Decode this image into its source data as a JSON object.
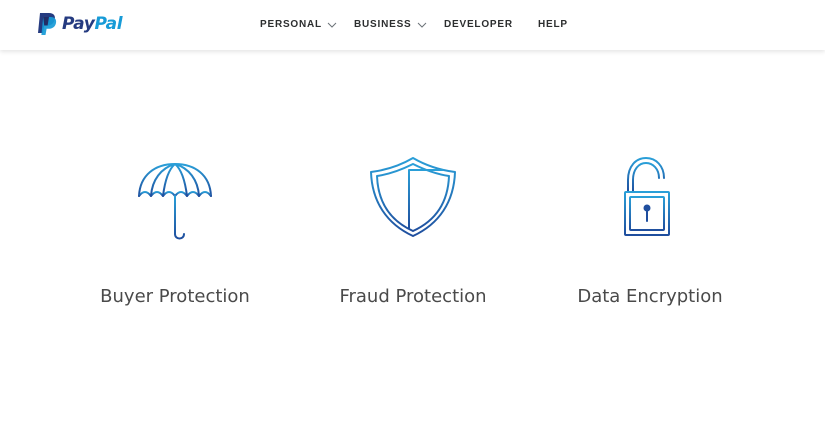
{
  "header": {
    "logo": {
      "text_pay": "Pay",
      "text_pal": "Pal",
      "icon": "paypal-logo-icon"
    },
    "nav": [
      {
        "label": "PERSONAL",
        "has_dropdown": true,
        "icon": "chevron-down-icon"
      },
      {
        "label": "BUSINESS",
        "has_dropdown": true,
        "icon": "chevron-down-icon"
      },
      {
        "label": "DEVELOPER",
        "has_dropdown": false
      },
      {
        "label": "HELP",
        "has_dropdown": false
      }
    ]
  },
  "features": [
    {
      "label": "Buyer Protection",
      "icon": "umbrella-icon"
    },
    {
      "label": "Fraud Protection",
      "icon": "shield-icon"
    },
    {
      "label": "Data Encryption",
      "icon": "unlocked-padlock-icon"
    }
  ],
  "colors": {
    "brand_dark_blue": "#253b80",
    "brand_light_blue": "#179bd7",
    "icon_stroke_light": "#2a9fd8",
    "icon_stroke_dark": "#1f4e9e",
    "nav_text": "#2c2e2f",
    "feature_text": "#4a4a4a"
  }
}
